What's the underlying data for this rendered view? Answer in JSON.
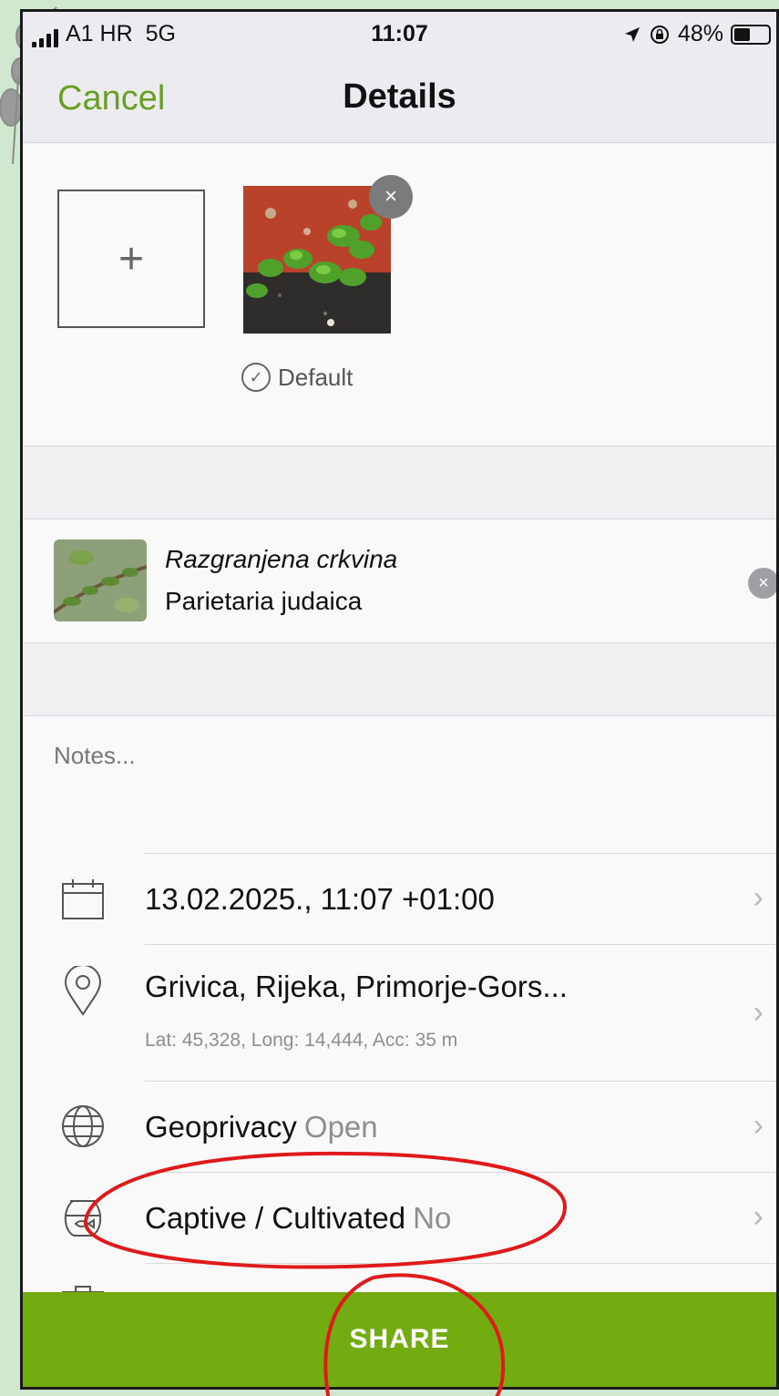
{
  "status_bar": {
    "carrier": "A1 HR",
    "network": "5G",
    "time": "11:07",
    "battery": "48%",
    "battery_fraction": 0.48
  },
  "nav": {
    "cancel_label": "Cancel",
    "title": "Details"
  },
  "photos": {
    "add_label": "+",
    "remove_label": "×",
    "default_label": "Default"
  },
  "taxon": {
    "common_name": "Razgranjena crkvina",
    "scientific_name": "Parietaria judaica",
    "clear_label": "×"
  },
  "notes": {
    "placeholder": "Notes..."
  },
  "rows": {
    "date": {
      "label": "13.02.2025., 11:07 +01:00",
      "icon": "calendar-icon"
    },
    "location": {
      "label": "Grivica, Rijeka, Primorje-Gors...",
      "detail": "Lat: 45,328, Long: 14,444, Acc: 35 m",
      "icon": "map-pin-icon"
    },
    "geoprivacy": {
      "label": "Geoprivacy",
      "value": "Open",
      "icon": "globe-icon"
    },
    "captive": {
      "label": "Captive / Cultivated",
      "value": "No",
      "icon": "fishbowl-icon"
    },
    "chevron": "›"
  },
  "share": {
    "label": "SHARE"
  },
  "colors": {
    "accent_green": "#73ac10",
    "link_green": "#6aa022",
    "annotation_red": "#e01a1a"
  }
}
